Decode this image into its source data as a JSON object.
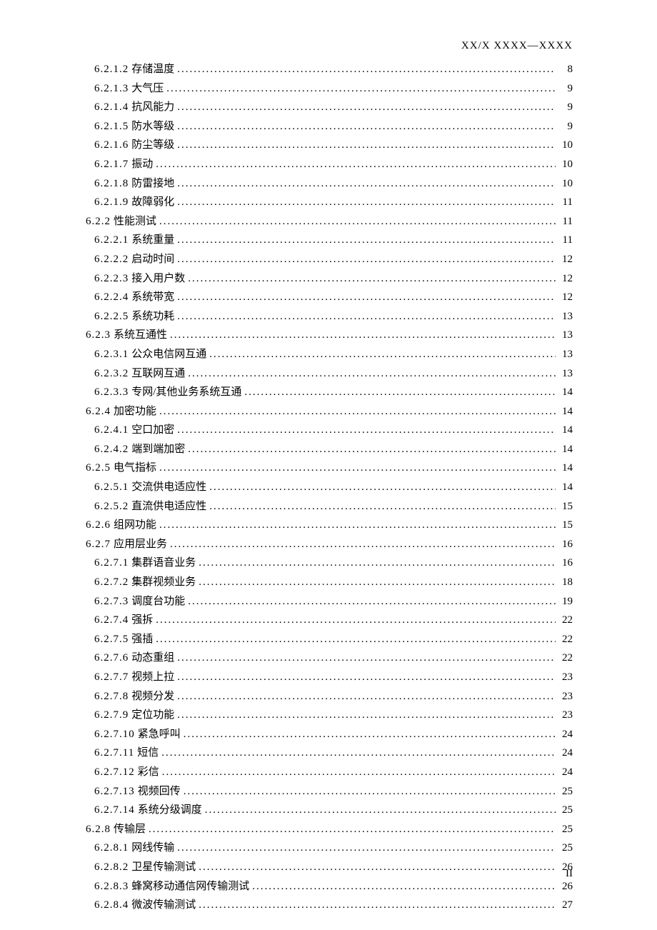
{
  "header": "XX/X XXXX—XXXX",
  "footer": "II",
  "toc": [
    {
      "num": "6.2.1.2",
      "title": "存储温度",
      "page": "8",
      "level": 3
    },
    {
      "num": "6.2.1.3",
      "title": "大气压",
      "page": "9",
      "level": 3
    },
    {
      "num": "6.2.1.4",
      "title": "抗风能力",
      "page": "9",
      "level": 3
    },
    {
      "num": "6.2.1.5",
      "title": "防水等级",
      "page": "9",
      "level": 3
    },
    {
      "num": "6.2.1.6",
      "title": "防尘等级",
      "page": "10",
      "level": 3
    },
    {
      "num": "6.2.1.7",
      "title": "振动",
      "page": "10",
      "level": 3
    },
    {
      "num": "6.2.1.8",
      "title": "防雷接地",
      "page": "10",
      "level": 3
    },
    {
      "num": "6.2.1.9",
      "title": "故障弱化",
      "page": "11",
      "level": 3
    },
    {
      "num": "6.2.2",
      "title": "性能测试",
      "page": "11",
      "level": 2
    },
    {
      "num": "6.2.2.1",
      "title": "系统重量",
      "page": "11",
      "level": 3
    },
    {
      "num": "6.2.2.2",
      "title": "启动时间",
      "page": "12",
      "level": 3
    },
    {
      "num": "6.2.2.3",
      "title": "接入用户数",
      "page": "12",
      "level": 3
    },
    {
      "num": "6.2.2.4",
      "title": "系统带宽",
      "page": "12",
      "level": 3
    },
    {
      "num": "6.2.2.5",
      "title": "系统功耗",
      "page": "13",
      "level": 3
    },
    {
      "num": "6.2.3",
      "title": "系统互通性",
      "page": "13",
      "level": 2
    },
    {
      "num": "6.2.3.1",
      "title": "公众电信网互通",
      "page": "13",
      "level": 3
    },
    {
      "num": "6.2.3.2",
      "title": "互联网互通",
      "page": "13",
      "level": 3
    },
    {
      "num": "6.2.3.3",
      "title": "专网/其他业务系统互通",
      "page": "14",
      "level": 3
    },
    {
      "num": "6.2.4",
      "title": "加密功能",
      "page": "14",
      "level": 2
    },
    {
      "num": "6.2.4.1",
      "title": "空口加密",
      "page": "14",
      "level": 3
    },
    {
      "num": "6.2.4.2",
      "title": "端到端加密",
      "page": "14",
      "level": 3
    },
    {
      "num": "6.2.5",
      "title": "电气指标",
      "page": "14",
      "level": 2
    },
    {
      "num": "6.2.5.1",
      "title": "交流供电适应性",
      "page": "14",
      "level": 3
    },
    {
      "num": "6.2.5.2",
      "title": "直流供电适应性",
      "page": "15",
      "level": 3
    },
    {
      "num": "6.2.6",
      "title": "组网功能",
      "page": "15",
      "level": 2
    },
    {
      "num": "6.2.7",
      "title": "应用层业务",
      "page": "16",
      "level": 2
    },
    {
      "num": "6.2.7.1",
      "title": "集群语音业务",
      "page": "16",
      "level": 3
    },
    {
      "num": "6.2.7.2",
      "title": "集群视频业务",
      "page": "18",
      "level": 3
    },
    {
      "num": "6.2.7.3",
      "title": "调度台功能",
      "page": "19",
      "level": 3
    },
    {
      "num": "6.2.7.4",
      "title": "强拆",
      "page": "22",
      "level": 3
    },
    {
      "num": "6.2.7.5",
      "title": "强插",
      "page": "22",
      "level": 3
    },
    {
      "num": "6.2.7.6",
      "title": "动态重组",
      "page": "22",
      "level": 3
    },
    {
      "num": "6.2.7.7",
      "title": "视频上拉",
      "page": "23",
      "level": 3
    },
    {
      "num": "6.2.7.8",
      "title": "视频分发",
      "page": "23",
      "level": 3
    },
    {
      "num": "6.2.7.9",
      "title": "定位功能",
      "page": "23",
      "level": 3
    },
    {
      "num": "6.2.7.10",
      "title": "紧急呼叫",
      "page": "24",
      "level": 3
    },
    {
      "num": "6.2.7.11",
      "title": "短信",
      "page": "24",
      "level": 3
    },
    {
      "num": "6.2.7.12",
      "title": "彩信",
      "page": "24",
      "level": 3
    },
    {
      "num": "6.2.7.13",
      "title": "视频回传",
      "page": "25",
      "level": 3
    },
    {
      "num": "6.2.7.14",
      "title": "系统分级调度",
      "page": "25",
      "level": 3
    },
    {
      "num": "6.2.8",
      "title": "传输层",
      "page": "25",
      "level": 2
    },
    {
      "num": "6.2.8.1",
      "title": "网线传输",
      "page": "25",
      "level": 3
    },
    {
      "num": "6.2.8.2",
      "title": "卫星传输测试",
      "page": "26",
      "level": 3
    },
    {
      "num": "6.2.8.3",
      "title": "蜂窝移动通信网传输测试",
      "page": "26",
      "level": 3
    },
    {
      "num": "6.2.8.4",
      "title": "微波传输测试",
      "page": "27",
      "level": 3
    }
  ]
}
